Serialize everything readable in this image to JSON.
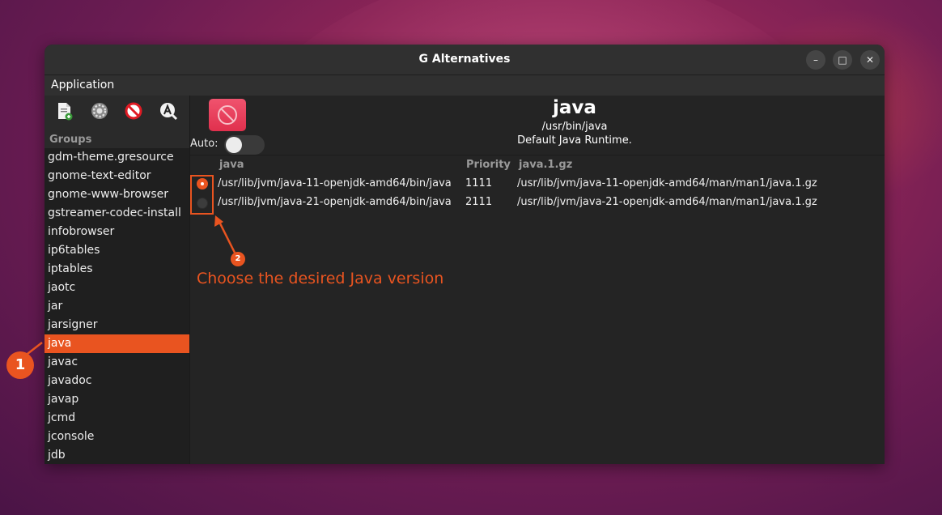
{
  "window": {
    "title": "G Alternatives",
    "controls": {
      "minimize": "–",
      "maximize": "□",
      "close": "✕"
    }
  },
  "menu": {
    "application": "Application"
  },
  "toolbar": {
    "icons": [
      "add-alternative-icon",
      "settings-icon",
      "remove-icon",
      "search-icon"
    ]
  },
  "sidebar": {
    "groups_label": "Groups",
    "items": [
      "gdm-theme.gresource",
      "gnome-text-editor",
      "gnome-www-browser",
      "gstreamer-codec-install",
      "infobrowser",
      "ip6tables",
      "iptables",
      "jaotc",
      "jar",
      "jarsigner",
      "java",
      "javac",
      "javadoc",
      "javap",
      "jcmd",
      "jconsole",
      "jdb"
    ],
    "selected": "java"
  },
  "details": {
    "name": "java",
    "link": "/usr/bin/java",
    "description": "Default Java Runtime.",
    "auto_label": "Auto:",
    "auto_enabled": false
  },
  "table": {
    "columns": [
      "java",
      "Priority",
      "java.1.gz"
    ],
    "rows": [
      {
        "selected": true,
        "path": "/usr/lib/jvm/java-11-openjdk-amd64/bin/java",
        "priority": "1111",
        "slave": "/usr/lib/jvm/java-11-openjdk-amd64/man/man1/java.1.gz"
      },
      {
        "selected": false,
        "path": "/usr/lib/jvm/java-21-openjdk-amd64/bin/java",
        "priority": "2111",
        "slave": "/usr/lib/jvm/java-21-openjdk-amd64/man/man1/java.1.gz"
      }
    ]
  },
  "annotations": {
    "badge1": "1",
    "badge2": "2",
    "note": "Choose the desired Java version"
  },
  "colors": {
    "accent": "#e95420",
    "window_bg": "#242424",
    "titlebar": "#303030"
  }
}
